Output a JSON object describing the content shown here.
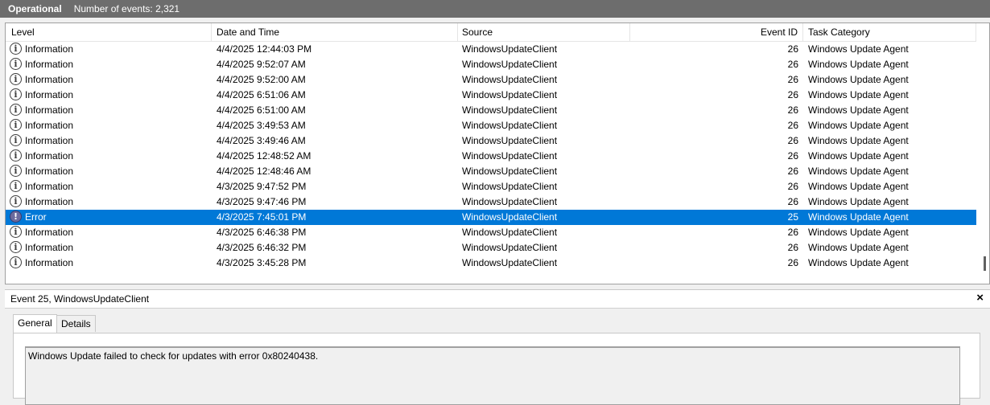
{
  "titlebar": {
    "name": "Operational",
    "count": "Number of events: 2,321"
  },
  "columns": [
    "Level",
    "Date and Time",
    "Source",
    "Event ID",
    "Task Category"
  ],
  "rows": [
    {
      "level": "Information",
      "datetime": "4/4/2025 12:44:03 PM",
      "source": "WindowsUpdateClient",
      "event_id": "26",
      "category": "Windows Update Agent"
    },
    {
      "level": "Information",
      "datetime": "4/4/2025 9:52:07 AM",
      "source": "WindowsUpdateClient",
      "event_id": "26",
      "category": "Windows Update Agent"
    },
    {
      "level": "Information",
      "datetime": "4/4/2025 9:52:00 AM",
      "source": "WindowsUpdateClient",
      "event_id": "26",
      "category": "Windows Update Agent"
    },
    {
      "level": "Information",
      "datetime": "4/4/2025 6:51:06 AM",
      "source": "WindowsUpdateClient",
      "event_id": "26",
      "category": "Windows Update Agent"
    },
    {
      "level": "Information",
      "datetime": "4/4/2025 6:51:00 AM",
      "source": "WindowsUpdateClient",
      "event_id": "26",
      "category": "Windows Update Agent"
    },
    {
      "level": "Information",
      "datetime": "4/4/2025 3:49:53 AM",
      "source": "WindowsUpdateClient",
      "event_id": "26",
      "category": "Windows Update Agent"
    },
    {
      "level": "Information",
      "datetime": "4/4/2025 3:49:46 AM",
      "source": "WindowsUpdateClient",
      "event_id": "26",
      "category": "Windows Update Agent"
    },
    {
      "level": "Information",
      "datetime": "4/4/2025 12:48:52 AM",
      "source": "WindowsUpdateClient",
      "event_id": "26",
      "category": "Windows Update Agent"
    },
    {
      "level": "Information",
      "datetime": "4/4/2025 12:48:46 AM",
      "source": "WindowsUpdateClient",
      "event_id": "26",
      "category": "Windows Update Agent"
    },
    {
      "level": "Information",
      "datetime": "4/3/2025 9:47:52 PM",
      "source": "WindowsUpdateClient",
      "event_id": "26",
      "category": "Windows Update Agent"
    },
    {
      "level": "Information",
      "datetime": "4/3/2025 9:47:46 PM",
      "source": "WindowsUpdateClient",
      "event_id": "26",
      "category": "Windows Update Agent"
    },
    {
      "level": "Error",
      "datetime": "4/3/2025 7:45:01 PM",
      "source": "WindowsUpdateClient",
      "event_id": "25",
      "category": "Windows Update Agent",
      "selected": true
    },
    {
      "level": "Information",
      "datetime": "4/3/2025 6:46:38 PM",
      "source": "WindowsUpdateClient",
      "event_id": "26",
      "category": "Windows Update Agent"
    },
    {
      "level": "Information",
      "datetime": "4/3/2025 6:46:32 PM",
      "source": "WindowsUpdateClient",
      "event_id": "26",
      "category": "Windows Update Agent"
    },
    {
      "level": "Information",
      "datetime": "4/3/2025 3:45:28 PM",
      "source": "WindowsUpdateClient",
      "event_id": "26",
      "category": "Windows Update Agent"
    }
  ],
  "icons": {
    "information": "information-icon",
    "error": "error-icon"
  },
  "details": {
    "title": "Event 25, WindowsUpdateClient",
    "close": "×",
    "tabs": [
      "General",
      "Details"
    ],
    "message": "Windows Update failed to check for updates with error 0x80240438."
  },
  "colors": {
    "selection": "#0078d7",
    "titlebar": "#6d6d6d"
  }
}
